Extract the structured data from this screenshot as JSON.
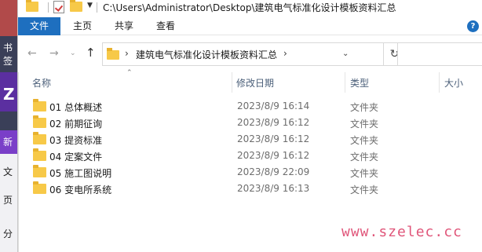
{
  "background_app": {
    "labels": [
      "书签",
      "Z",
      "新",
      "文",
      "页",
      "分"
    ]
  },
  "window": {
    "title": "C:\\Users\\Administrator\\Desktop\\建筑电气标准化设计模板资料汇总"
  },
  "ribbon": {
    "tabs": [
      "文件",
      "主页",
      "共享",
      "查看"
    ],
    "help": "?"
  },
  "address_bar": {
    "path_segment": "建筑电气标准化设计模板资料汇总"
  },
  "columns": {
    "name": "名称",
    "date": "修改日期",
    "type": "类型",
    "size": "大小"
  },
  "files": [
    {
      "name": "01 总体概述",
      "date": "2023/8/9 16:14",
      "type": "文件夹"
    },
    {
      "name": "02 前期征询",
      "date": "2023/8/9 16:12",
      "type": "文件夹"
    },
    {
      "name": "03 提资标准",
      "date": "2023/8/9 16:12",
      "type": "文件夹"
    },
    {
      "name": "04 定案文件",
      "date": "2023/8/9 16:12",
      "type": "文件夹"
    },
    {
      "name": "05 施工图说明",
      "date": "2023/8/9 22:09",
      "type": "文件夹"
    },
    {
      "name": "06 变电所系统",
      "date": "2023/8/9 16:13",
      "type": "文件夹"
    }
  ],
  "watermark": "www.szelec.cc"
}
